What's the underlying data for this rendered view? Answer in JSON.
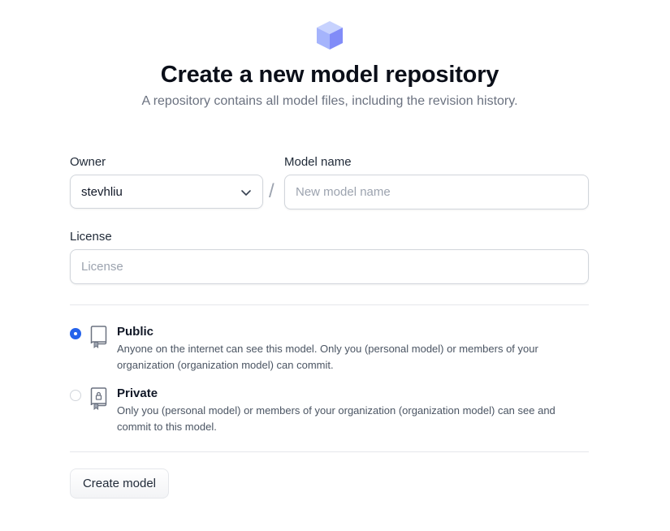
{
  "page": {
    "title": "Create a new model repository",
    "subtitle": "A repository contains all model files, including the revision history."
  },
  "form": {
    "owner": {
      "label": "Owner",
      "value": "stevhliu"
    },
    "separator": "/",
    "model_name": {
      "label": "Model name",
      "placeholder": "New model name",
      "value": ""
    },
    "license": {
      "label": "License",
      "placeholder": "License",
      "value": ""
    },
    "visibility": {
      "selected": "public",
      "options": [
        {
          "id": "public",
          "title": "Public",
          "description": "Anyone on the internet can see this model. Only you (personal model) or members of your organization (organization model) can commit.",
          "icon": "repo-book-icon"
        },
        {
          "id": "private",
          "title": "Private",
          "description": "Only you (personal model) or members of your organization (organization model) can see and commit to this model.",
          "icon": "repo-lock-icon"
        }
      ]
    },
    "submit_label": "Create model"
  },
  "colors": {
    "accent": "#2563eb",
    "cube_top": "#c7d2fe",
    "cube_left": "#a5b4fc",
    "cube_right": "#818cf8"
  }
}
